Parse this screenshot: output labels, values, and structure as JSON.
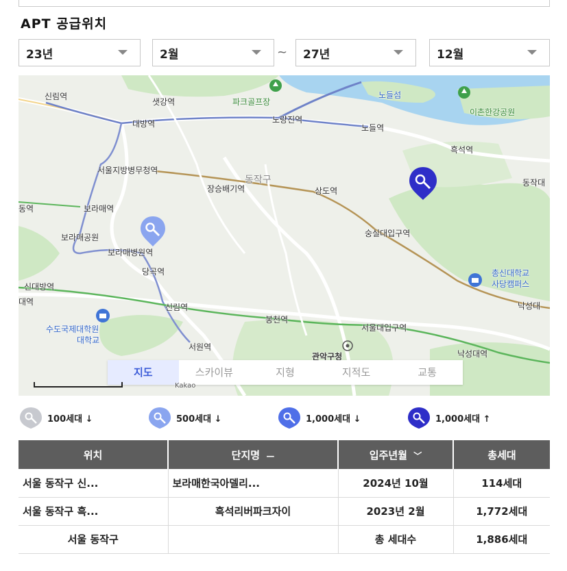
{
  "section": {
    "title": "APT 공급위치"
  },
  "filters": {
    "from_year": "23년",
    "from_month": "2월",
    "separator": "~",
    "to_year": "27년",
    "to_month": "12월"
  },
  "map": {
    "labels": {
      "sillim_top": "신림역",
      "saetgang": "샛강역",
      "park_golf": "파크골프장",
      "nodeulseom": "노들섬",
      "ichon_park": "이촌한강공원",
      "daebang": "대방역",
      "noryangjin": "노량진역",
      "nodeul": "노들역",
      "heukseok": "흑석역",
      "seoul_gov": "서울지방병무청역",
      "dongjak_gu": "동작구",
      "jangseungbaegi": "장승배기역",
      "sangdo": "상도역",
      "dongjakdae": "동작대",
      "station_left": "동역",
      "boramae": "보라매역",
      "soongsil": "숭실대입구역",
      "boramae_park": "보라매공원",
      "boramae_hospital": "보라매병원역",
      "danggok": "당곡역",
      "chongshin": "총신대학교",
      "sadang_campus": "사당캠퍼스",
      "sindaebang": "신대방역",
      "station_left2": "대역",
      "sillim": "신림역",
      "nakseongdae_right": "낙성대",
      "bongcheon": "봉천역",
      "snu": "서울대입구역",
      "sudo_univ": "수도국제대학원",
      "daehakgyo": "대학교",
      "seowon": "서원역",
      "gwanak": "관악구청",
      "nakseongdae": "낙성대역"
    },
    "tabs": [
      "지도",
      "스카이뷰",
      "지형",
      "지적도",
      "교통"
    ],
    "active_tab": "지도",
    "scale_text": "Kakao"
  },
  "legend": [
    {
      "label": "100세대 ↓",
      "color": "#c7c9cf",
      "icon": "location-marker-icon"
    },
    {
      "label": "500세대 ↓",
      "color": "#8aa5ef",
      "icon": "location-marker-icon"
    },
    {
      "label": "1,000세대 ↓",
      "color": "#4f6fe8",
      "icon": "location-marker-icon"
    },
    {
      "label": "1,000세대 ↑",
      "color": "#2e2ec8",
      "icon": "location-marker-icon"
    }
  ],
  "table": {
    "headers": {
      "location": "위치",
      "complex": "단지명",
      "complex_sort": "—",
      "move_in": "입주년월",
      "move_in_sort": "﹀",
      "total": "총세대"
    },
    "rows": [
      {
        "location": "서울 동작구 신...",
        "complex": "보라매한국아델리...",
        "move_in": "2024년 10월",
        "total": "114세대"
      },
      {
        "location": "서울 동작구 흑...",
        "complex": "흑석리버파크자이",
        "move_in": "2023년 2월",
        "total": "1,772세대"
      }
    ],
    "footer": {
      "location": "서울 동작구",
      "label": "총 세대수",
      "total": "1,886세대"
    }
  },
  "colors": {
    "header_bg": "#5d5d5d",
    "accent_blue": "#3b5bd8",
    "river": "#a8d4f0",
    "park": "#cfe8c4"
  }
}
